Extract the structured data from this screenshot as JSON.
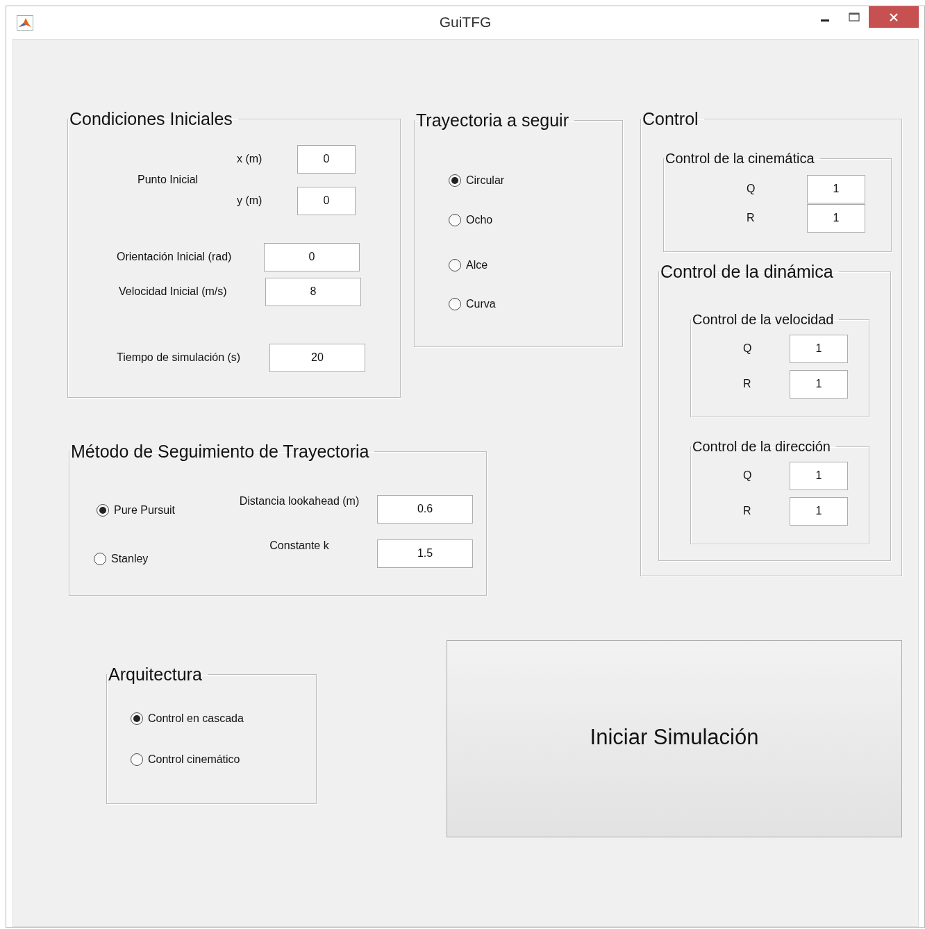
{
  "window": {
    "title": "GuiTFG"
  },
  "condiciones_iniciales": {
    "title": "Condiciones Iniciales",
    "punto_inicial": {
      "label": "Punto Inicial",
      "fields": [
        {
          "label": "x (m)",
          "value": "0"
        },
        {
          "label": "y (m)",
          "value": "0"
        }
      ]
    },
    "fields": [
      {
        "label": "Orientación Inicial (rad)",
        "value": "0"
      },
      {
        "label": "Velocidad Inicial (m/s)",
        "value": "8"
      },
      {
        "label": "Tiempo de simulación (s)",
        "value": "20"
      }
    ]
  },
  "trayectoria": {
    "title": "Trayectoria a seguir",
    "options": [
      {
        "label": "Circular",
        "selected": true
      },
      {
        "label": "Ocho",
        "selected": false
      },
      {
        "label": "Alce",
        "selected": false
      },
      {
        "label": "Curva",
        "selected": false
      }
    ]
  },
  "control": {
    "title": "Control",
    "cinematica": {
      "title": "Control de la cinemática",
      "fields": [
        {
          "label": "Q",
          "value": "1"
        },
        {
          "label": "R",
          "value": "1"
        }
      ]
    },
    "dinamica": {
      "title": "Control de la dinámica",
      "groups": [
        {
          "title": "Control de la velocidad",
          "fields": [
            {
              "label": "Q",
              "value": "1"
            },
            {
              "label": "R",
              "value": "1"
            }
          ]
        },
        {
          "title": "Control de la dirección",
          "fields": [
            {
              "label": "Q",
              "value": "1"
            },
            {
              "label": "R",
              "value": "1"
            }
          ]
        }
      ]
    }
  },
  "metodo": {
    "title": "Método de Seguimiento de Trayectoria",
    "options": [
      {
        "label": "Pure Pursuit",
        "selected": true
      },
      {
        "label": "Stanley",
        "selected": false
      }
    ],
    "fields": [
      {
        "label": "Distancia lookahead (m)",
        "value": "0.6"
      },
      {
        "label": "Constante k",
        "value": "1.5"
      }
    ]
  },
  "arquitectura": {
    "title": "Arquitectura",
    "options": [
      {
        "label": "Control en cascada",
        "selected": true
      },
      {
        "label": "Control cinemático",
        "selected": false
      }
    ]
  },
  "start_button": {
    "label": "Iniciar Simulación"
  }
}
